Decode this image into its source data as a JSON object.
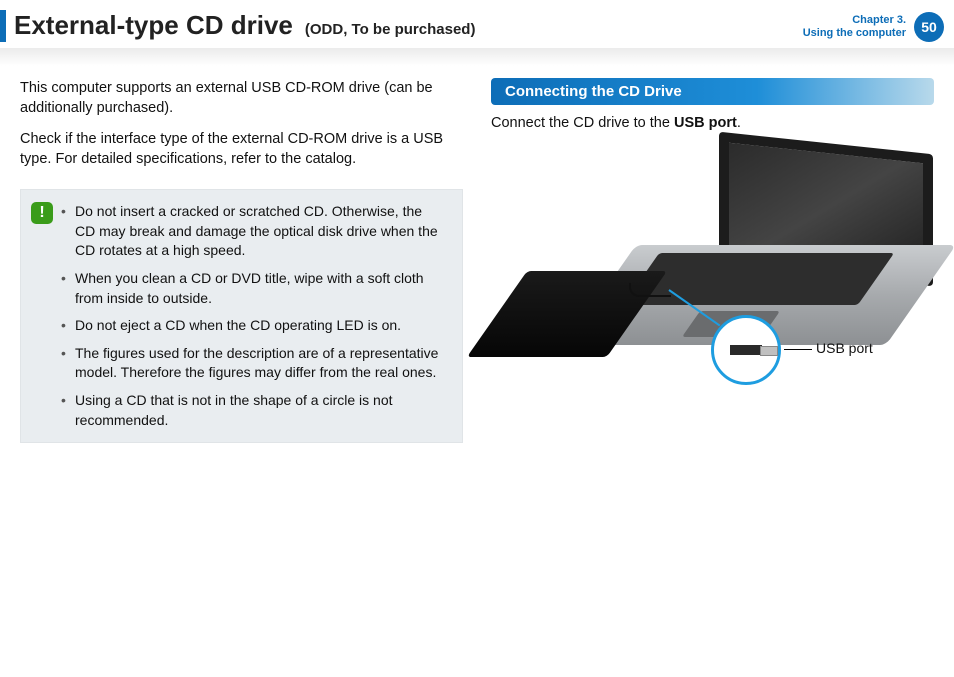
{
  "header": {
    "title": "External-type CD drive",
    "subtitle": "(ODD, To be purchased)",
    "chapter_line1": "Chapter 3.",
    "chapter_line2": "Using the computer",
    "page_number": "50"
  },
  "left": {
    "para1": "This computer supports an external USB CD-ROM drive (can be additionally purchased).",
    "para2": "Check if the interface type of the external CD-ROM drive is a USB type. For detailed specifications, refer to the catalog.",
    "caution_icon": "!",
    "cautions": [
      "Do not insert a cracked or scratched CD. Otherwise, the CD may break and damage the optical disk drive when the CD rotates at a high speed.",
      "When you clean a CD or DVD title, wipe with a soft cloth from inside to outside.",
      "Do not eject a CD when the CD operating LED is on.",
      "The figures used for the description are of a representative model. Therefore the figures may differ from the real ones.",
      "Using a CD that is not in the shape of a circle is not recommended."
    ]
  },
  "right": {
    "section_title": "Connecting the CD Drive",
    "connect_text_pre": "Connect the CD drive to the ",
    "connect_text_bold": "USB port",
    "connect_text_post": ".",
    "usb_label": "USB port"
  }
}
